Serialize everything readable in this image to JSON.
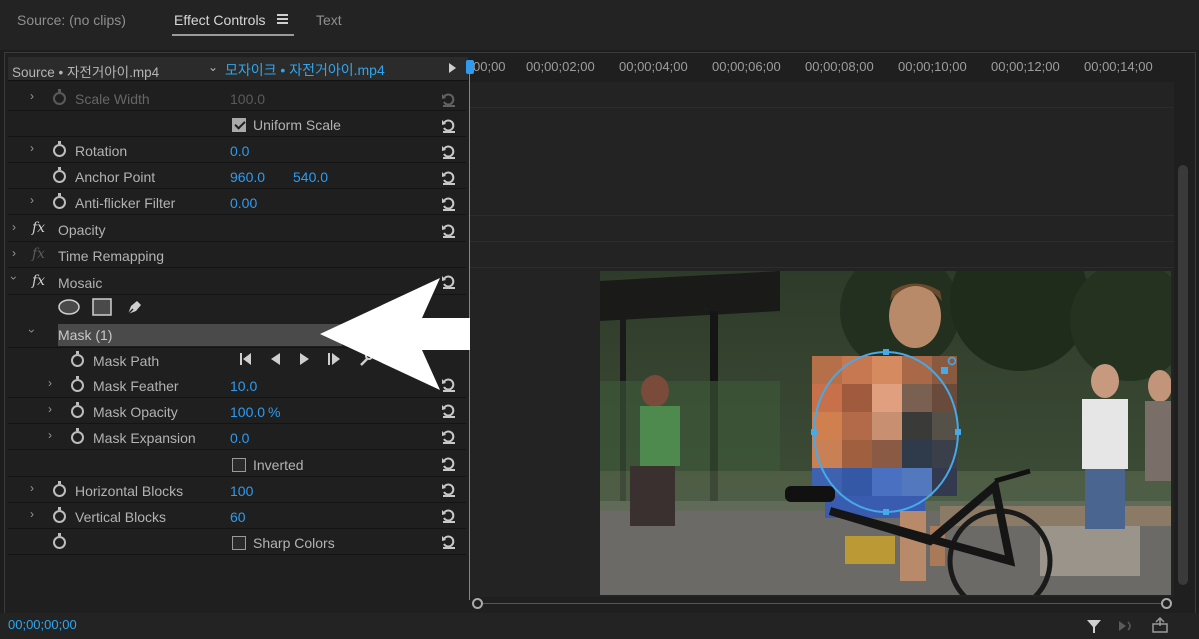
{
  "tabs": {
    "source": "Source: (no clips)",
    "effect_controls": "Effect Controls",
    "text": "Text"
  },
  "source_row": {
    "master": "Source • 자전거아이.mp4",
    "sequence_clip": "모자이크 • 자전거아이.mp4"
  },
  "ruler": [
    "00;00",
    "00;00;02;00",
    "00;00;04;00",
    "00;00;06;00",
    "00;00;08;00",
    "00;00;10;00",
    "00;00;12;00",
    "00;00;14;00"
  ],
  "props": {
    "scale_width": {
      "label": "Scale Width",
      "value": "100.0"
    },
    "uniform_scale": {
      "label": "Uniform Scale",
      "checked": true
    },
    "rotation": {
      "label": "Rotation",
      "value": "0.0"
    },
    "anchor_point": {
      "label": "Anchor Point",
      "x": "960.0",
      "y": "540.0"
    },
    "anti_flicker": {
      "label": "Anti-flicker Filter",
      "value": "0.00"
    },
    "opacity": {
      "label": "Opacity"
    },
    "time_remapping": {
      "label": "Time Remapping"
    },
    "mosaic": {
      "label": "Mosaic"
    },
    "mask": {
      "label": "Mask (1)"
    },
    "mask_path": {
      "label": "Mask Path"
    },
    "mask_feather": {
      "label": "Mask Feather",
      "value": "10.0"
    },
    "mask_opacity": {
      "label": "Mask Opacity",
      "value": "100.0",
      "unit": "%"
    },
    "mask_expansion": {
      "label": "Mask Expansion",
      "value": "0.0"
    },
    "inverted": {
      "label": "Inverted",
      "checked": false
    },
    "horizontal_blocks": {
      "label": "Horizontal Blocks",
      "value": "100"
    },
    "vertical_blocks": {
      "label": "Vertical Blocks",
      "value": "60"
    },
    "sharp_colors": {
      "label": "Sharp Colors",
      "checked": false
    }
  },
  "fx_symbol": "fx",
  "timecode": "00;00;00;00",
  "colors": {
    "accent": "#2e9bf0",
    "panel": "#1f1f1f"
  }
}
